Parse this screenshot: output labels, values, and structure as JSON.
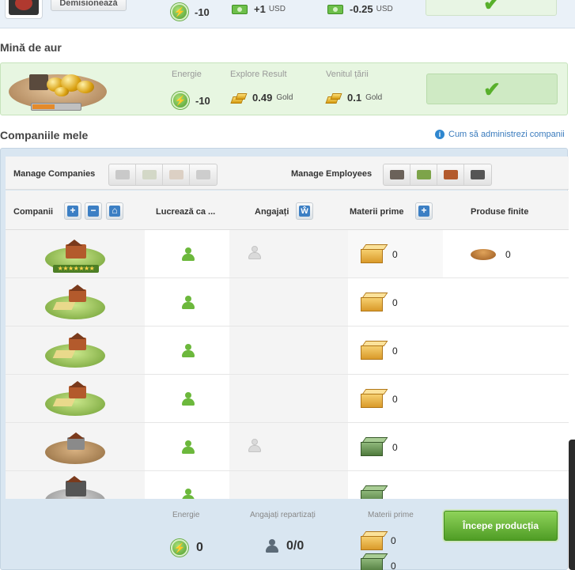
{
  "top": {
    "resign_label": "Demisionează",
    "energy": "-10",
    "salary_value": "+1",
    "salary_unit": "USD",
    "tax_value": "-0.25",
    "tax_unit": "USD"
  },
  "mine": {
    "title": "Mină de aur",
    "energy_label": "Energie",
    "energy_value": "-10",
    "explore_label": "Explore Result",
    "explore_value": "0.49",
    "explore_unit": "Gold",
    "country_label": "Venitul țării",
    "country_value": "0.1",
    "country_unit": "Gold",
    "progress_fraction": 0.45
  },
  "companies": {
    "title": "Companiile mele",
    "help_link": "Cum să administrezi companii",
    "manage_companies_label": "Manage Companies",
    "manage_employees_label": "Manage Employees",
    "columns": {
      "companies": "Companii",
      "works_as": "Lucrează ca ...",
      "employees": "Angajați",
      "raw": "Materii prime",
      "finished": "Produse finite"
    },
    "rows": [
      {
        "type": "headquarters",
        "employee": true,
        "raw": "0",
        "finished": "0"
      },
      {
        "type": "farm",
        "employee": false,
        "raw": "0",
        "finished": ""
      },
      {
        "type": "farm",
        "employee": false,
        "raw": "0",
        "finished": ""
      },
      {
        "type": "farm",
        "employee": false,
        "raw": "0",
        "finished": ""
      },
      {
        "type": "mine",
        "employee": true,
        "raw": "0",
        "finished": ""
      },
      {
        "type": "factory",
        "employee": false,
        "raw": "",
        "finished": ""
      }
    ]
  },
  "footer": {
    "energy_label": "Energie",
    "energy_value": "0",
    "employees_label": "Angajați repartizați",
    "employees_value": "0/0",
    "raw_label": "Materii prime",
    "raw_food_value": "0",
    "raw_weapon_value": "0",
    "start_label": "Începe producția"
  },
  "colors": {
    "accent_green": "#58b02b",
    "panel_blue": "#d9e6f1",
    "mine_green": "#e7f6e1"
  }
}
